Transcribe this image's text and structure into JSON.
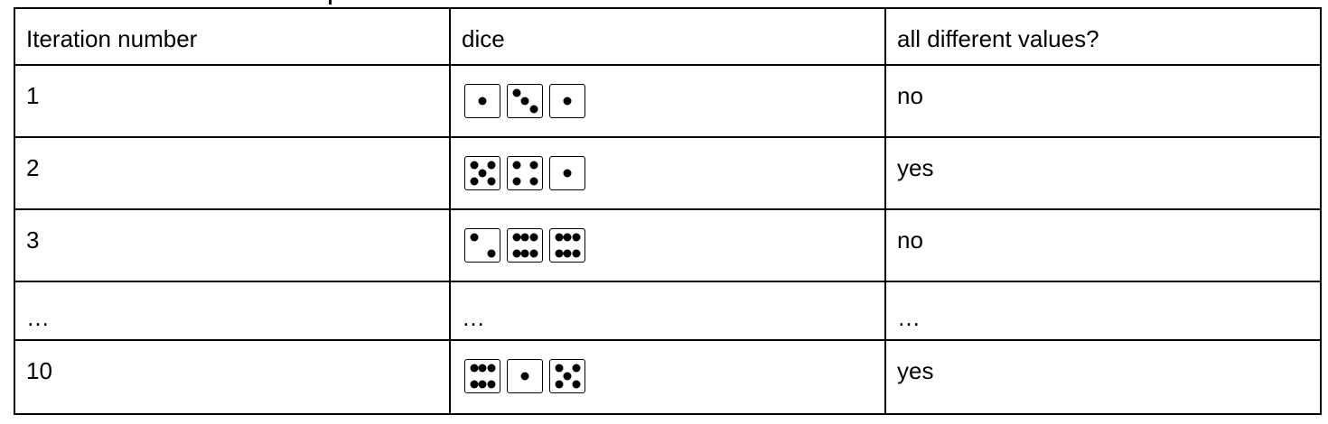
{
  "table": {
    "headers": [
      "Iteration number",
      "dice",
      "all different values?"
    ],
    "rows": [
      {
        "iteration": "1",
        "dice": [
          1,
          3,
          1
        ],
        "all_different": "no"
      },
      {
        "iteration": "2",
        "dice": [
          5,
          4,
          1
        ],
        "all_different": "yes"
      },
      {
        "iteration": "3",
        "dice": [
          2,
          6,
          6
        ],
        "all_different": "no"
      },
      {
        "iteration": "…",
        "dice_text": "…",
        "all_different": "…"
      },
      {
        "iteration": "10",
        "dice": [
          6,
          1,
          5
        ],
        "all_different": "yes"
      }
    ]
  }
}
